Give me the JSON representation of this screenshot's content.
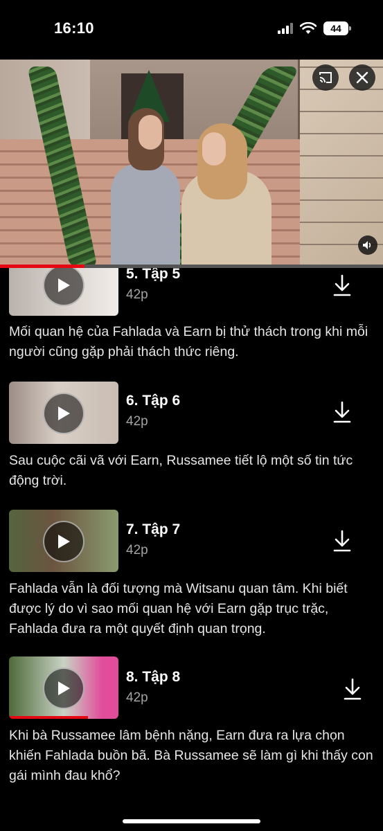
{
  "status": {
    "time": "16:10",
    "battery": "44"
  },
  "player": {
    "cast_icon": "cast-icon",
    "close_icon": "close-icon",
    "mute_icon": "speaker-muted-icon",
    "progress_fraction": 0.22
  },
  "episodes": [
    {
      "title": "5. Tập 5",
      "duration": "42p",
      "description": "Mối quan hệ của Fahlada và Earn bị thử thách trong khi mỗi người cũng gặp phải thách thức riêng.",
      "watched_fraction": 0
    },
    {
      "title": "6. Tập 6",
      "duration": "42p",
      "description": "Sau cuộc cãi vã với Earn, Russamee tiết lộ một số tin tức động trời.",
      "watched_fraction": 0
    },
    {
      "title": "7. Tập 7",
      "duration": "42p",
      "description": "Fahlada vẫn là đối tượng mà Witsanu quan tâm. Khi biết được lý do vì sao mối quan hệ với Earn gặp trục trặc, Fahlada đưa ra một quyết định quan trọng.",
      "watched_fraction": 0
    },
    {
      "title": "8. Tập 8",
      "duration": "42p",
      "description": "Khi bà Russamee lâm bệnh nặng, Earn đưa ra lựa chọn khiến Fahlada buồn bã. Bà Russamee sẽ làm gì khi thấy con gái mình đau khổ?",
      "watched_fraction": 0.72
    }
  ]
}
